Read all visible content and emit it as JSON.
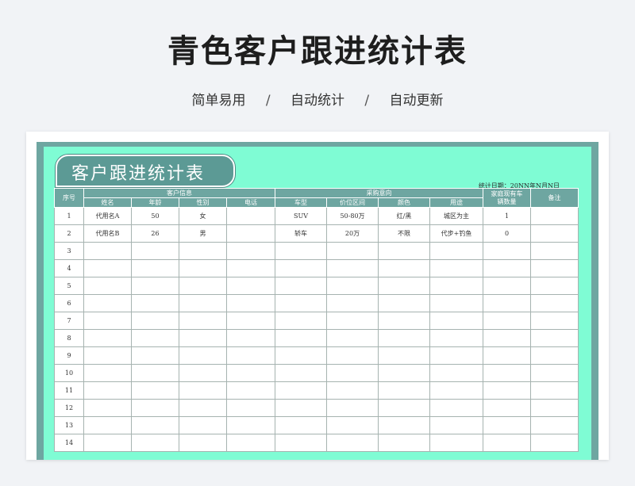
{
  "page": {
    "title": "青色客户跟进统计表",
    "tags": [
      "简单易用",
      "自动统计",
      "自动更新"
    ],
    "separator": "/"
  },
  "sheet": {
    "banner_title": "客户跟进统计表",
    "stat_date": "统计日期：20NN年N月N日",
    "groups": {
      "index": "序号",
      "customer_info": "客户信息",
      "purchase_intent": "采购意向",
      "family_cars": "家庭现有车辆数量",
      "remarks": "备注"
    },
    "columns": {
      "name": "姓名",
      "age": "年龄",
      "gender": "性别",
      "phone": "电话",
      "car_type": "车型",
      "price_range": "价位区间",
      "color": "颜色",
      "usage": "用途"
    },
    "rows": [
      {
        "no": "1",
        "name": "代用名A",
        "age": "50",
        "gender": "女",
        "phone": "",
        "car_type": "SUV",
        "price_range": "50-80万",
        "color": "红/黑",
        "usage": "城区为主",
        "cars": "1",
        "remark": ""
      },
      {
        "no": "2",
        "name": "代用名B",
        "age": "26",
        "gender": "男",
        "phone": "",
        "car_type": "轿车",
        "price_range": "20万",
        "color": "不限",
        "usage": "代步+钓鱼",
        "cars": "0",
        "remark": ""
      },
      {
        "no": "3",
        "name": "",
        "age": "",
        "gender": "",
        "phone": "",
        "car_type": "",
        "price_range": "",
        "color": "",
        "usage": "",
        "cars": "",
        "remark": ""
      },
      {
        "no": "4",
        "name": "",
        "age": "",
        "gender": "",
        "phone": "",
        "car_type": "",
        "price_range": "",
        "color": "",
        "usage": "",
        "cars": "",
        "remark": ""
      },
      {
        "no": "5",
        "name": "",
        "age": "",
        "gender": "",
        "phone": "",
        "car_type": "",
        "price_range": "",
        "color": "",
        "usage": "",
        "cars": "",
        "remark": ""
      },
      {
        "no": "6",
        "name": "",
        "age": "",
        "gender": "",
        "phone": "",
        "car_type": "",
        "price_range": "",
        "color": "",
        "usage": "",
        "cars": "",
        "remark": ""
      },
      {
        "no": "7",
        "name": "",
        "age": "",
        "gender": "",
        "phone": "",
        "car_type": "",
        "price_range": "",
        "color": "",
        "usage": "",
        "cars": "",
        "remark": ""
      },
      {
        "no": "8",
        "name": "",
        "age": "",
        "gender": "",
        "phone": "",
        "car_type": "",
        "price_range": "",
        "color": "",
        "usage": "",
        "cars": "",
        "remark": ""
      },
      {
        "no": "9",
        "name": "",
        "age": "",
        "gender": "",
        "phone": "",
        "car_type": "",
        "price_range": "",
        "color": "",
        "usage": "",
        "cars": "",
        "remark": ""
      },
      {
        "no": "10",
        "name": "",
        "age": "",
        "gender": "",
        "phone": "",
        "car_type": "",
        "price_range": "",
        "color": "",
        "usage": "",
        "cars": "",
        "remark": ""
      },
      {
        "no": "11",
        "name": "",
        "age": "",
        "gender": "",
        "phone": "",
        "car_type": "",
        "price_range": "",
        "color": "",
        "usage": "",
        "cars": "",
        "remark": ""
      },
      {
        "no": "12",
        "name": "",
        "age": "",
        "gender": "",
        "phone": "",
        "car_type": "",
        "price_range": "",
        "color": "",
        "usage": "",
        "cars": "",
        "remark": ""
      },
      {
        "no": "13",
        "name": "",
        "age": "",
        "gender": "",
        "phone": "",
        "car_type": "",
        "price_range": "",
        "color": "",
        "usage": "",
        "cars": "",
        "remark": ""
      },
      {
        "no": "14",
        "name": "",
        "age": "",
        "gender": "",
        "phone": "",
        "car_type": "",
        "price_range": "",
        "color": "",
        "usage": "",
        "cars": "",
        "remark": ""
      }
    ]
  },
  "colors": {
    "header_teal": "#6ea6a1",
    "mint_background": "#7ffcd4",
    "page_background": "#f1f3f6"
  }
}
